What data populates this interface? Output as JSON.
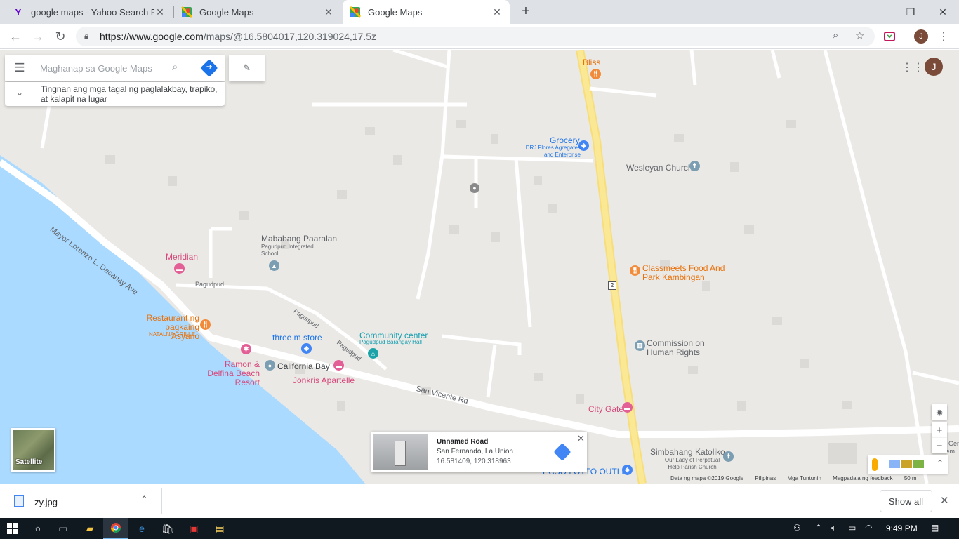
{
  "tabs": [
    {
      "title": "google maps - Yahoo Search Res",
      "favicon": "yahoo-icon",
      "active": false
    },
    {
      "title": "Google Maps",
      "favicon": "maps-icon",
      "active": false
    },
    {
      "title": "Google Maps",
      "favicon": "maps-icon",
      "active": true
    }
  ],
  "toolbar": {
    "url_host": "https://www.google.com",
    "url_path": "/maps/@16.5804017,120.319024,17.5z",
    "profile_initial": "J"
  },
  "search": {
    "placeholder": "Maghanap sa Google Maps",
    "suggestion": "Tingnan ang mga tagal ng paglalakbay, trapiko, at kalapit na lugar"
  },
  "map_avatar_initial": "J",
  "places": {
    "bliss": "Bliss",
    "grocery": "Grocery",
    "drj": "DRJ Flores Agregates and Enterprise",
    "wesleyan": "Wesleyan Church",
    "paaralan": "Mababang Paaralan",
    "paaralan_sub": "Pagudpud Integrated School",
    "meridian": "Meridian",
    "classmeets": "Classmeets Food And Park Kambingan",
    "restaurant": "Restaurant ng pagkaing Asyano",
    "natalna": "NATALNA GRILLE",
    "community": "Community center",
    "community_sub": "Pagudpud Barangay Hall",
    "threem": "three m store",
    "commission": "Commission on Human Rights",
    "ramon": "Ramon & Delfina Beach Resort",
    "california": "California Bay",
    "jonkris": "Jonkris Apartelle",
    "citygate": "City Gate",
    "simbahan": "Simbahang Katoliko",
    "simbahan_sub": "Our Lady of Perpetual Help Parish Church",
    "pcso": "PCSO LOTTO OUTLET",
    "cgen": "Ci Gen Mem"
  },
  "roads": {
    "mayor": "Mayor Lorenzo L. Dacanay Ave",
    "pagudpud1": "Pagudpud",
    "pagudpud2": "Pagudpud",
    "pagudpud3": "Pagudpud",
    "sanvicente": "San Vicente Rd",
    "route": "2"
  },
  "satellite_label": "Satellite",
  "infocard": {
    "title": "Unnamed Road",
    "address": "San Fernando, La Union",
    "coords": "16.581409, 120.318963"
  },
  "footer": {
    "data": "Data ng mapa ©2019 Google",
    "country": "Pilipinas",
    "terms": "Mga Tuntunin",
    "feedback": "Magpadala ng feedback",
    "scale": "50 m"
  },
  "download": {
    "filename": "zy.jpg",
    "show_all": "Show all"
  },
  "taskbar": {
    "time": "9:49 PM"
  }
}
